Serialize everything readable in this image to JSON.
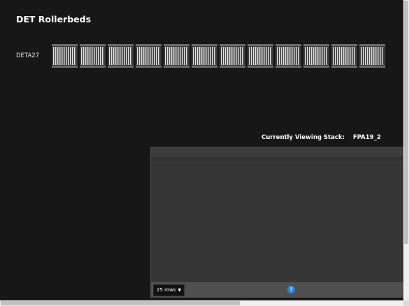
{
  "page": {
    "title": "DET Rollerbeds"
  },
  "row": {
    "label": "DETA27",
    "rollerbed_count": 12
  },
  "stack": {
    "label": "Currently Viewing Stack:",
    "value": "FPA19_2"
  },
  "grid": {
    "rows_label": "25 rows",
    "info_glyph": "!"
  },
  "colors": {
    "background": "#171717",
    "grid": "#363636",
    "info": "#2e86d6"
  }
}
